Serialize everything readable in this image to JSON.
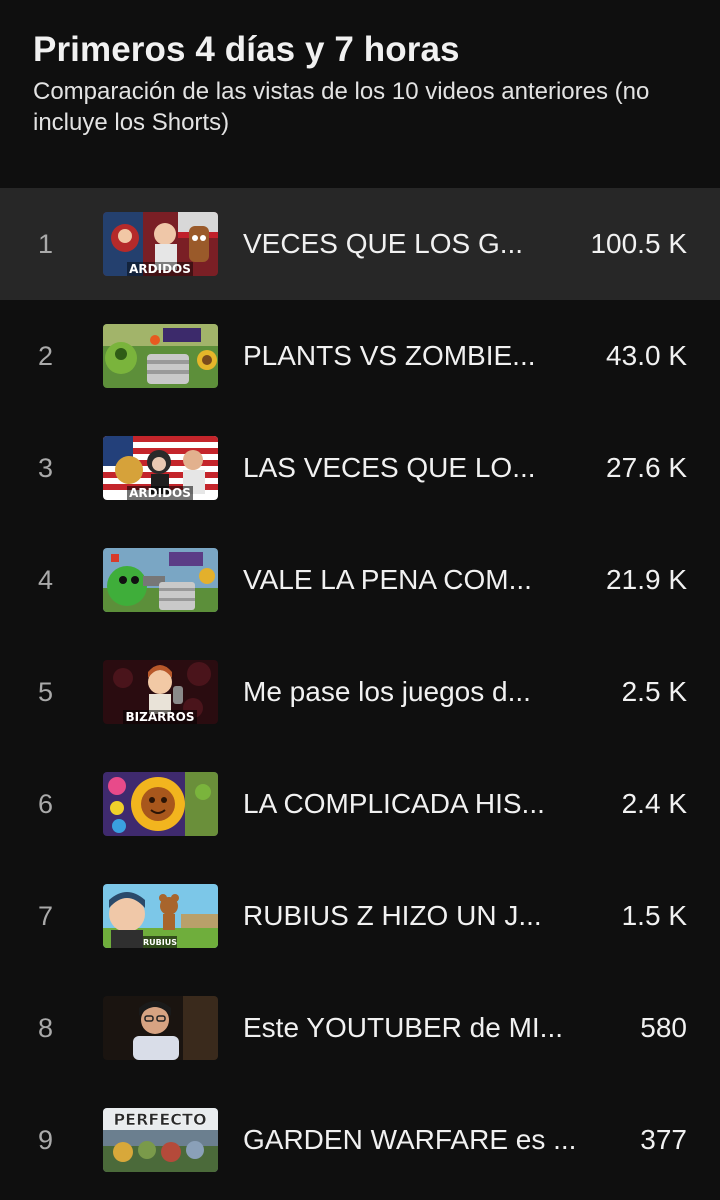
{
  "header": {
    "title": "Primeros 4 días y 7 horas",
    "subtitle": "Comparación de las vistas de los 10 videos anteriores (no incluye los Shorts)"
  },
  "videos": [
    {
      "rank": "1",
      "title": "VECES QUE LOS G...",
      "views": "100.5 K",
      "thumb_text": "ARDIDOS",
      "thumb_icon": "ardidos-thumbnail"
    },
    {
      "rank": "2",
      "title": "PLANTS VS ZOMBIE...",
      "views": "43.0 K",
      "thumb_text": "",
      "thumb_icon": "plants-vs-zombies-thumbnail"
    },
    {
      "rank": "3",
      "title": "LAS VECES QUE LO...",
      "views": "27.6 K",
      "thumb_text": "ARDIDOS",
      "thumb_icon": "ardidos-flag-thumbnail"
    },
    {
      "rank": "4",
      "title": "VALE LA PENA COM...",
      "views": "21.9 K",
      "thumb_text": "",
      "thumb_icon": "green-character-thumbnail"
    },
    {
      "rank": "5",
      "title": "Me pase los juegos d...",
      "views": "2.5 K",
      "thumb_text": "BIZARROS",
      "thumb_icon": "bizarros-thumbnail"
    },
    {
      "rank": "6",
      "title": "LA COMPLICADA HIS...",
      "views": "2.4 K",
      "thumb_text": "",
      "thumb_icon": "sunflower-thumbnail"
    },
    {
      "rank": "7",
      "title": "RUBIUS Z HIZO UN J...",
      "views": "1.5 K",
      "thumb_text": "RUBIUS",
      "thumb_icon": "rubius-thumbnail"
    },
    {
      "rank": "8",
      "title": "Este YOUTUBER de MI...",
      "views": "580",
      "thumb_text": "",
      "thumb_icon": "youtuber-thumbnail"
    },
    {
      "rank": "9",
      "title": "GARDEN WARFARE es ...",
      "views": "377",
      "thumb_text": "PERFECTO",
      "thumb_icon": "garden-warfare-thumbnail"
    }
  ],
  "colors": {
    "background": "#0f0f0f",
    "row_highlight": "#272727",
    "text_primary": "#f1f1f1",
    "text_secondary": "#aaaaaa"
  }
}
